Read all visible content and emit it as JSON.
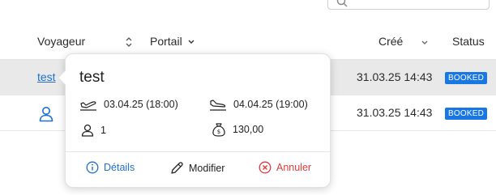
{
  "table": {
    "columns": {
      "traveler": "Voyageur",
      "portal": "Portail",
      "created": "Créé",
      "status": "Status"
    },
    "rows": [
      {
        "traveler": "test",
        "created": "31.03.25 14:43",
        "status": "BOOKED"
      },
      {
        "traveler_icon": "user-icon",
        "created": "31.03.25 14:43",
        "status": "BOOKED"
      }
    ]
  },
  "popover": {
    "title": "test",
    "departure": "03.04.25 (18:00)",
    "arrival": "04.04.25 (19:00)",
    "travelers": "1",
    "amount": "130,00",
    "actions": {
      "details": "Détails",
      "edit": "Modifier",
      "cancel": "Annuler"
    }
  },
  "colors": {
    "accent": "#1f6fd1",
    "badge": "#1877e4",
    "danger": "#e23b3b",
    "row_highlight": "#e9e9e9"
  }
}
